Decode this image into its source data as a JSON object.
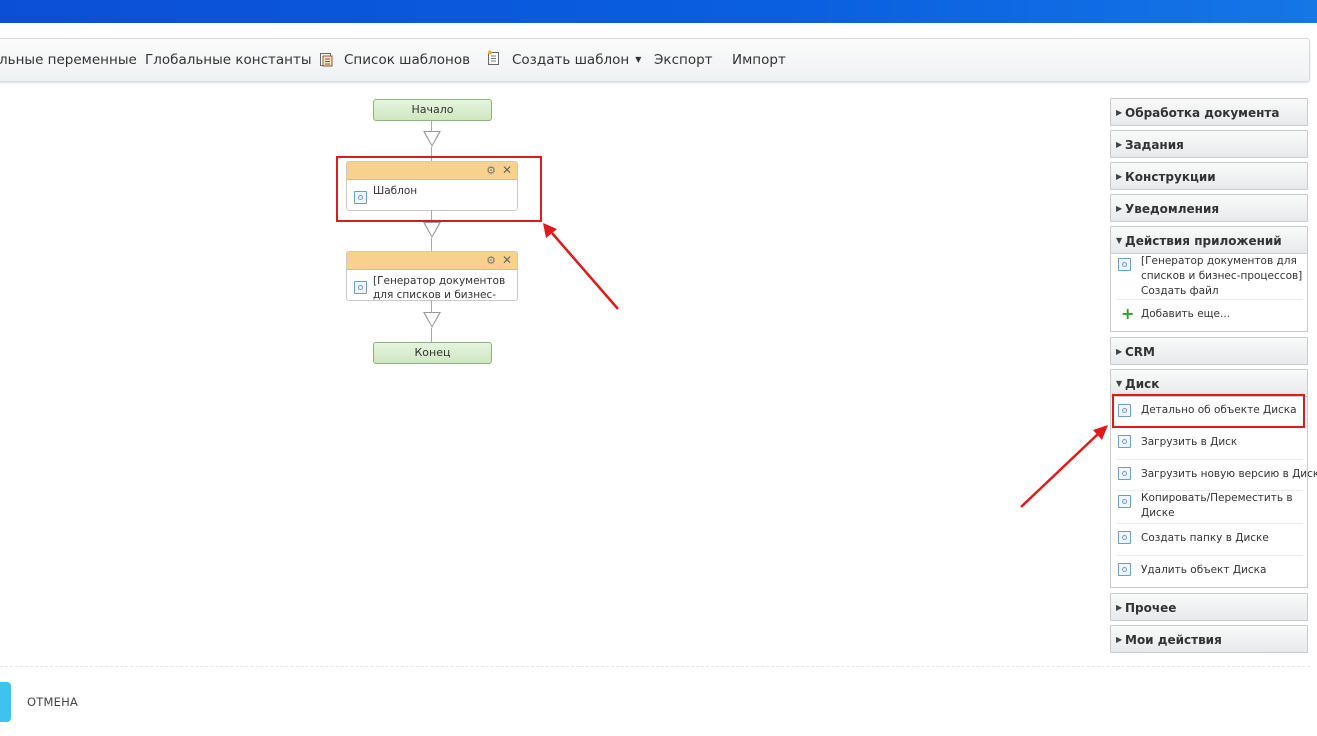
{
  "toolbar": {
    "items": [
      {
        "label": "льные переменные"
      },
      {
        "label": "Глобальные константы"
      },
      {
        "label": "Список шаблонов",
        "icon": "template-list-icon"
      },
      {
        "label": "Создать шаблон",
        "icon": "create-template-icon"
      },
      {
        "label": "Экспорт"
      },
      {
        "label": "Импорт"
      }
    ]
  },
  "workflow": {
    "start": "Начало",
    "activities": [
      {
        "title": "Шаблон"
      },
      {
        "title": "[Генератор документов для списков и бизнес-"
      }
    ],
    "end": "Конец"
  },
  "side_panel": {
    "sections": [
      {
        "label": "Обработка документа",
        "expanded": false
      },
      {
        "label": "Задания",
        "expanded": false
      },
      {
        "label": "Конструкции",
        "expanded": false
      },
      {
        "label": "Уведомления",
        "expanded": false
      },
      {
        "label": "Действия приложений",
        "expanded": true,
        "items": [
          "[Генератор документов для списков и бизнес-процессов] Создать файл"
        ],
        "add_more": "Добавить еще..."
      },
      {
        "label": "CRM",
        "expanded": false
      },
      {
        "label": "Диск",
        "expanded": true,
        "items": [
          "Детально об объекте Диска",
          "Загрузить в Диск",
          "Загрузить новую версию в Диск",
          "Копировать/Переместить в Диске",
          "Создать папку в Диске",
          "Удалить объект Диска"
        ]
      },
      {
        "label": "Прочее",
        "expanded": false
      },
      {
        "label": "Мои действия",
        "expanded": false
      }
    ]
  },
  "footer": {
    "cancel_label": "ОТМЕНА"
  },
  "colors": {
    "topbar": "#0b4fd6",
    "highlight_red": "#e01a1a",
    "activity_header": "#f8d28d",
    "terminal_node": "#cfe8c0",
    "cancel_accent": "#3fc3ee"
  }
}
